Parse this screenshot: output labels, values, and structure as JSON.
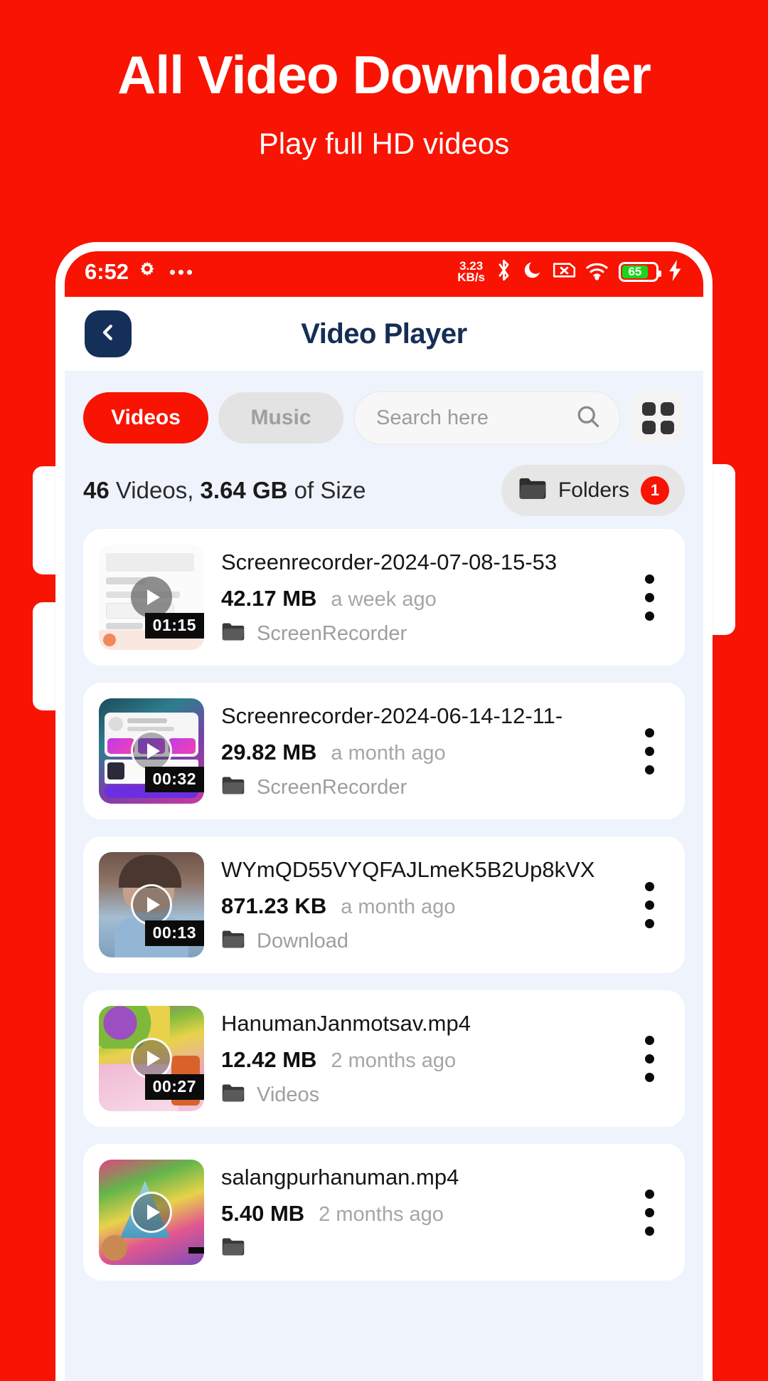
{
  "promo": {
    "title": "All Video Downloader",
    "subtitle": "Play full HD videos",
    "background_color": "#F91302"
  },
  "status_bar": {
    "time": "6:52",
    "gear_icon": "gear-icon",
    "overflow_icon": "more-dots-icon",
    "net_speed_value": "3.23",
    "net_speed_unit": "KB/s",
    "bluetooth_icon": "bluetooth-icon",
    "dnd_icon": "moon-icon",
    "no_sim_icon": "sim-x-icon",
    "wifi_icon": "wifi-icon",
    "battery_percent": "65",
    "battery_color": "#19D619",
    "charging_icon": "lightning-bolt-icon"
  },
  "appbar": {
    "back_icon": "chevron-left-icon",
    "title": "Video Player",
    "title_color": "#152E56"
  },
  "controls": {
    "tabs": [
      {
        "label": "Videos",
        "active": true
      },
      {
        "label": "Music",
        "active": false
      }
    ],
    "search": {
      "placeholder": "Search here",
      "value": "",
      "icon": "search-icon"
    },
    "grid_view_icon": "grid-view-icon"
  },
  "stats": {
    "count": "46",
    "count_label": "Videos,",
    "size": "3.64 GB",
    "size_label": "of Size",
    "folders_label": "Folders",
    "folders_icon": "folder-icon",
    "folders_badge": "1",
    "badge_color": "#F91302"
  },
  "videos": [
    {
      "title": "Screenrecorder-2024-07-08-15-53",
      "size": "42.17 MB",
      "age": "a week ago",
      "folder": "ScreenRecorder",
      "duration": "01:15",
      "thumb_class": "t1"
    },
    {
      "title": "Screenrecorder-2024-06-14-12-11-",
      "size": "29.82 MB",
      "age": "a month ago",
      "folder": "ScreenRecorder",
      "duration": "00:32",
      "thumb_class": "t2"
    },
    {
      "title": "WYmQD55VYQFAJLmeK5B2Up8kVX",
      "size": "871.23 KB",
      "age": "a month ago",
      "folder": "Download",
      "duration": "00:13",
      "thumb_class": "t3"
    },
    {
      "title": "HanumanJanmotsav.mp4",
      "size": "12.42 MB",
      "age": "2 months ago",
      "folder": "Videos",
      "duration": "00:27",
      "thumb_class": "t4"
    },
    {
      "title": "salangpurhanuman.mp4",
      "size": "5.40 MB",
      "age": "2 months ago",
      "folder": "",
      "duration": "",
      "thumb_class": "t5"
    }
  ]
}
